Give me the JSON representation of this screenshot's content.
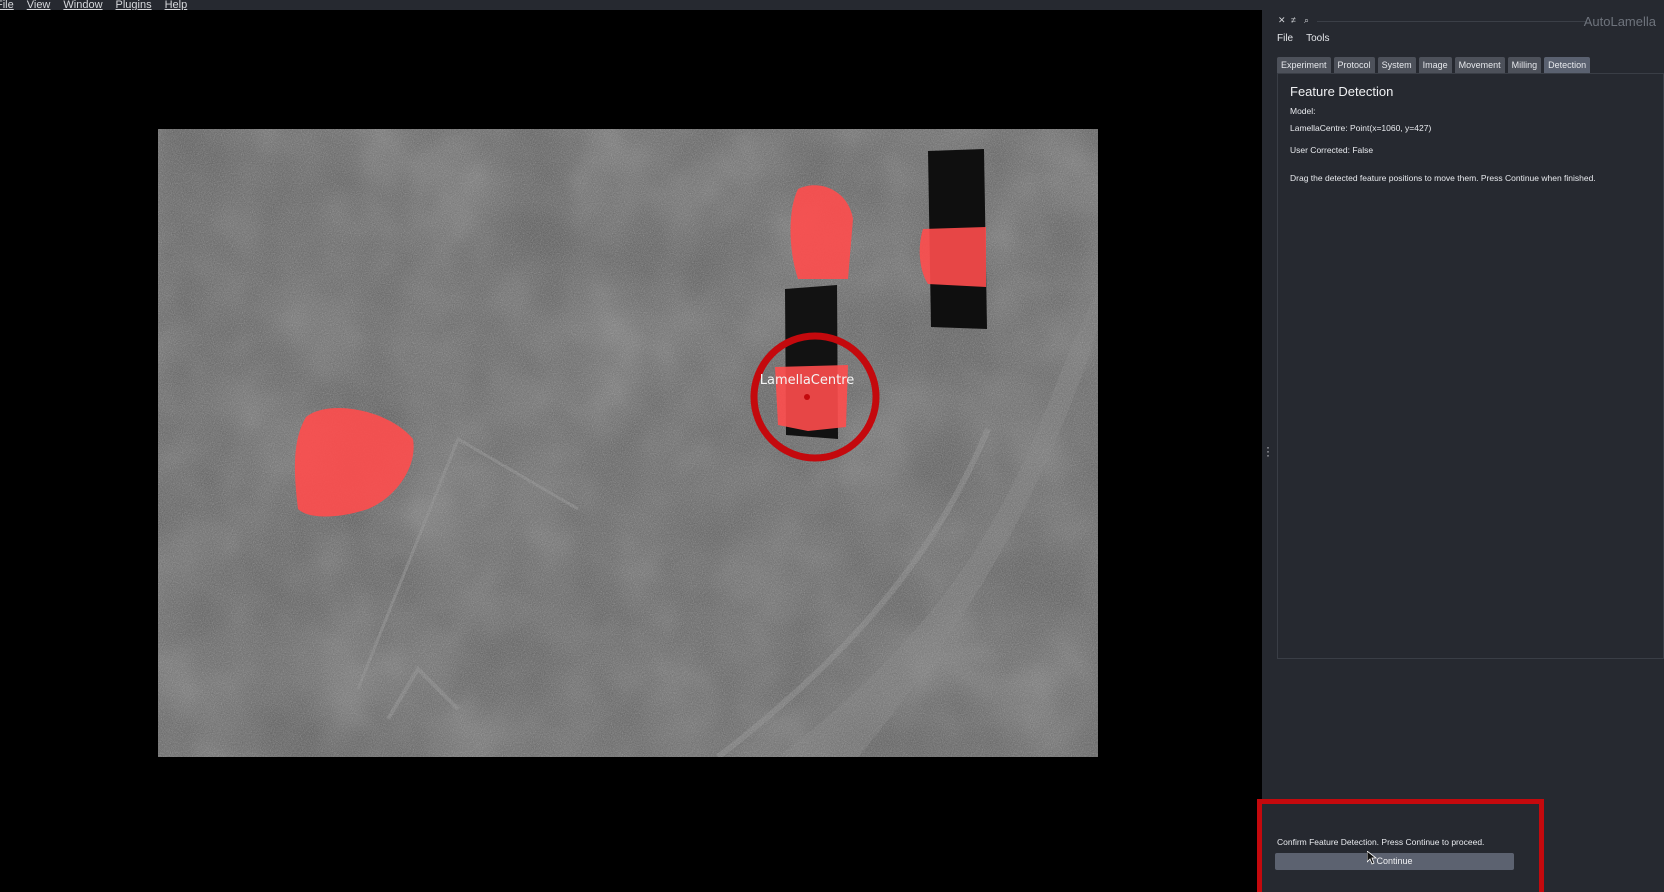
{
  "menubar": {
    "items": [
      "File",
      "View",
      "Window",
      "Plugins",
      "Help"
    ]
  },
  "dock": {
    "title": "AutoLamella",
    "menu": [
      "File",
      "Tools"
    ],
    "tabs": [
      "Experiment",
      "Protocol",
      "System",
      "Image",
      "Movement",
      "Milling",
      "Detection"
    ],
    "active_tab": "Detection",
    "panel": {
      "title": "Feature Detection",
      "model_label": "Model:",
      "feature_line": "LamellaCentre: Point(x=1060, y=427)",
      "user_corrected": "User Corrected: False",
      "instructions": "Drag the detected feature positions to move them. Press Continue when finished."
    },
    "status": {
      "message": "Confirm Feature Detection. Press Continue to proceed.",
      "continue_label": "Continue",
      "highlight_color": "#c4090d"
    }
  },
  "viewer": {
    "feature_label": "LamellaCentre",
    "mask_color": "#ff4c4c",
    "marker_color": "#c4090d"
  }
}
